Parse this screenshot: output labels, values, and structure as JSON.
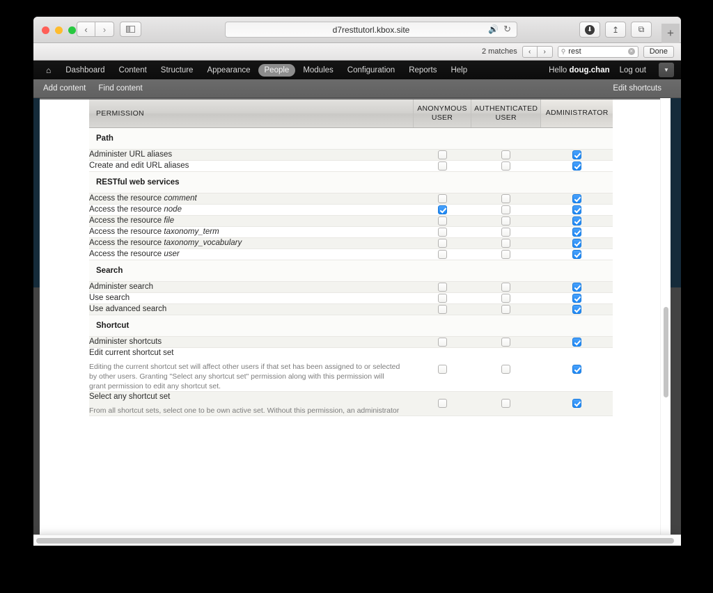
{
  "browser": {
    "url": "d7resttutorl.kbox.site",
    "back_label": "‹",
    "forward_label": "›",
    "sidebar_icon": "sidebar-icon",
    "speaker_icon": "🔊",
    "reload_icon": "↻",
    "download_icon": "⬇",
    "share_icon": "⤴",
    "tabs_icon": "⧉",
    "new_tab_label": "+"
  },
  "find_bar": {
    "match_count": "2 matches",
    "prev_label": "‹",
    "next_label": "›",
    "search_icon": "⚲",
    "query": "rest",
    "clear_label": "×",
    "done_label": "Done"
  },
  "admin_toolbar": {
    "home_icon": "⌂",
    "items": [
      {
        "label": "Dashboard",
        "active": false
      },
      {
        "label": "Content",
        "active": false
      },
      {
        "label": "Structure",
        "active": false
      },
      {
        "label": "Appearance",
        "active": false
      },
      {
        "label": "People",
        "active": true
      },
      {
        "label": "Modules",
        "active": false
      },
      {
        "label": "Configuration",
        "active": false
      },
      {
        "label": "Reports",
        "active": false
      },
      {
        "label": "Help",
        "active": false
      }
    ],
    "greeting_prefix": "Hello ",
    "username": "doug.chan",
    "logout_label": "Log out",
    "collapse_icon": "▼"
  },
  "shortcut_bar": {
    "items": [
      "Add content",
      "Find content"
    ],
    "edit_label": "Edit shortcuts"
  },
  "table": {
    "columns": {
      "permission": "PERMISSION",
      "roles": [
        {
          "line1": "ANONYMOUS",
          "line2": "USER"
        },
        {
          "line1": "AUTHENTICATED",
          "line2": "USER"
        },
        {
          "line1": "ADMINISTRATOR",
          "line2": ""
        }
      ]
    },
    "sections": [
      {
        "title": "Path",
        "rows": [
          {
            "label": "Administer URL aliases",
            "em": "",
            "desc": "",
            "checks": [
              false,
              false,
              true
            ]
          },
          {
            "label": "Create and edit URL aliases",
            "em": "",
            "desc": "",
            "checks": [
              false,
              false,
              true
            ]
          }
        ]
      },
      {
        "title": "RESTful web services",
        "rows": [
          {
            "label": "Access the resource ",
            "em": "comment",
            "desc": "",
            "checks": [
              false,
              false,
              true
            ]
          },
          {
            "label": "Access the resource ",
            "em": "node",
            "desc": "",
            "checks": [
              true,
              false,
              true
            ]
          },
          {
            "label": "Access the resource ",
            "em": "file",
            "desc": "",
            "checks": [
              false,
              false,
              true
            ]
          },
          {
            "label": "Access the resource ",
            "em": "taxonomy_term",
            "desc": "",
            "checks": [
              false,
              false,
              true
            ]
          },
          {
            "label": "Access the resource ",
            "em": "taxonomy_vocabulary",
            "desc": "",
            "checks": [
              false,
              false,
              true
            ]
          },
          {
            "label": "Access the resource ",
            "em": "user",
            "desc": "",
            "checks": [
              false,
              false,
              true
            ]
          }
        ]
      },
      {
        "title": "Search",
        "rows": [
          {
            "label": "Administer search",
            "em": "",
            "desc": "",
            "checks": [
              false,
              false,
              true
            ]
          },
          {
            "label": "Use search",
            "em": "",
            "desc": "",
            "checks": [
              false,
              false,
              true
            ]
          },
          {
            "label": "Use advanced search",
            "em": "",
            "desc": "",
            "checks": [
              false,
              false,
              true
            ]
          }
        ]
      },
      {
        "title": "Shortcut",
        "rows": [
          {
            "label": "Administer shortcuts",
            "em": "",
            "desc": "",
            "checks": [
              false,
              false,
              true
            ]
          },
          {
            "label": "Edit current shortcut set",
            "em": "",
            "desc": "Editing the current shortcut set will affect other users if that set has been assigned to or selected by other users. Granting \"Select any shortcut set\" permission along with this permission will grant permission to edit any shortcut set.",
            "checks": [
              false,
              false,
              true
            ]
          },
          {
            "label": "Select any shortcut set",
            "em": "",
            "desc": "From all shortcut sets, select one to be own active set. Without this permission, an administrator",
            "checks": [
              false,
              false,
              true
            ]
          }
        ]
      }
    ]
  },
  "colors": {
    "accent_checkbox": "#1c87f5",
    "page_background": "#152b3a",
    "toolbar_background": "#0c0c0c",
    "shortcut_background": "#616161"
  }
}
